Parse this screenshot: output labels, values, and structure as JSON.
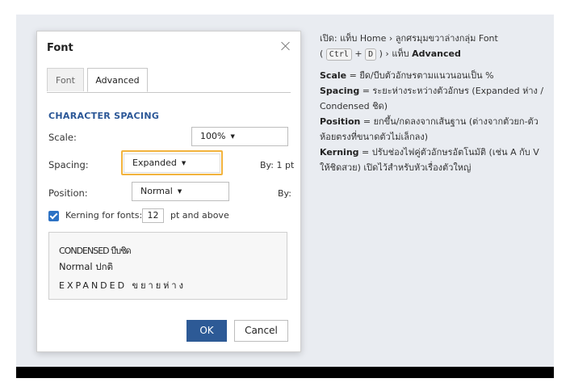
{
  "dialog": {
    "title": "Font",
    "tabs": [
      {
        "label": "Font",
        "active": false
      },
      {
        "label": "Advanced",
        "active": true
      }
    ],
    "section_heading": "CHARACTER SPACING",
    "scale": {
      "label": "Scale:",
      "value": "100%"
    },
    "spacing": {
      "label": "Spacing:",
      "value": "Expanded",
      "by_label": "By:",
      "by_value": "1 pt"
    },
    "position": {
      "label": "Position:",
      "value": "Normal",
      "by_label": "By:"
    },
    "kerning": {
      "checked": true,
      "label": "Kerning for fonts:",
      "size": "12",
      "suffix": "pt and above"
    },
    "preview": {
      "condensed": "CONDENSED บีบชิด",
      "normal": "Normal ปกติ",
      "expanded": "EXPANDED ขยายห่าง"
    },
    "ok_label": "OK",
    "cancel_label": "Cancel"
  },
  "notes": {
    "path_prefix": "เปิด: แท็บ Home › ลูกศรมุมขวาล่างกลุ่ม Font",
    "shortcut_open": "(",
    "key_ctrl": "Ctrl",
    "plus": "+",
    "key_d": "D",
    "shortcut_close": ") › แท็บ",
    "advanced_word": "Advanced",
    "items": [
      {
        "term": "Scale",
        "desc": " = ยืด/บีบตัวอักษรตามแนวนอนเป็น %"
      },
      {
        "term": "Spacing",
        "desc": " = ระยะห่างระหว่างตัวอักษร (Expanded ห่าง / Condensed ชิด)"
      },
      {
        "term": "Position",
        "desc": " = ยกขึ้น/กดลงจากเส้นฐาน (ต่างจากตัวยก-ตัวห้อยตรงที่ขนาดตัวไม่เล็กลง)"
      },
      {
        "term": "Kerning",
        "desc": " = ปรับช่องไฟคู่ตัวอักษรอัตโนมัติ (เช่น A กับ V ให้ชิดสวย) เปิดไว้สำหรับหัวเรื่องตัวใหญ่"
      }
    ]
  },
  "colors": {
    "accent": "#2d5a96",
    "highlight": "#f2b33d",
    "heading": "#2b5797",
    "checkbox": "#2d72c4"
  }
}
